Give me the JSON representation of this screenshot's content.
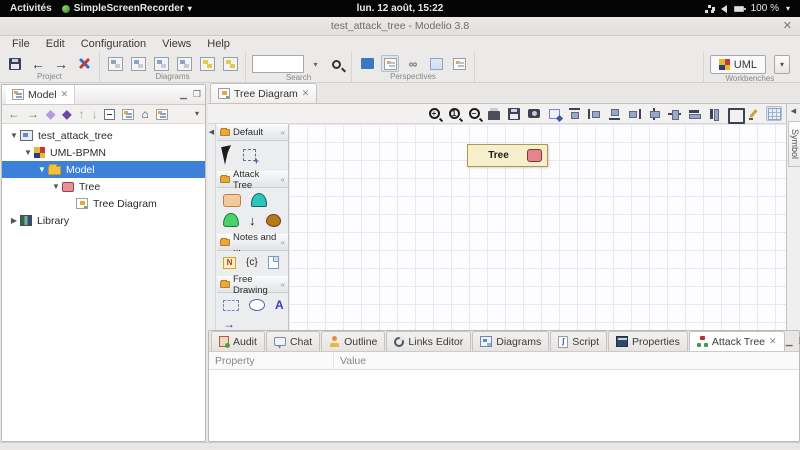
{
  "desktop": {
    "activities_label": "Activités",
    "recorder_label": "SimpleScreenRecorder",
    "clock": "lun. 12 août, 15:22",
    "battery_label": "100 %"
  },
  "window": {
    "title": "test_attack_tree - Modelio 3.8"
  },
  "menus": {
    "items": [
      {
        "label": "File"
      },
      {
        "label": "Edit"
      },
      {
        "label": "Configuration"
      },
      {
        "label": "Views"
      },
      {
        "label": "Help"
      }
    ]
  },
  "toolbar": {
    "project_label": "Project",
    "diagrams_label": "Diagrams",
    "search_label": "Search",
    "perspectives_label": "Perspectives",
    "workbenches_label": "Workbenches",
    "workbench_value": "UML",
    "search_value": "",
    "icons": [
      "save-icon",
      "undo-icon",
      "redo-icon",
      "tools-icon",
      "diagram-type-icons",
      "search-icon",
      "model-explorer-icon",
      "outline-perspective-icon",
      "links-perspective-icon",
      "grid-perspective-icon",
      "matrix-perspective-icon",
      "workbench-cube-icon"
    ]
  },
  "model_panel": {
    "tab_label": "Model",
    "nav_icons": [
      "back-arrow-icon",
      "forward-arrow-icon",
      "related-diamond-icon",
      "related-diamond-dark-icon",
      "move-up-icon",
      "move-down-icon",
      "collapse-all-icon",
      "link-with-editor-icon",
      "home-icon",
      "sync-tree-icon"
    ],
    "tree": [
      {
        "label": "test_attack_tree",
        "icon": "project-icon"
      },
      {
        "label": "UML-BPMN",
        "icon": "module-cube-icon"
      },
      {
        "label": "Model",
        "icon": "folder-icon",
        "selected": true
      },
      {
        "label": "Tree",
        "icon": "tree-element-icon"
      },
      {
        "label": "Tree Diagram",
        "icon": "diagram-icon"
      },
      {
        "label": "Library",
        "icon": "library-icon"
      }
    ]
  },
  "editor": {
    "tab_label": "Tree Diagram",
    "symbol_tab_label": "Symbol",
    "toolbar_icons": [
      "zoom-in-icon",
      "zoom-original-icon",
      "zoom-out-icon",
      "print-icon",
      "save-image-icon",
      "screenshot-icon",
      "marquee-zoom-icon",
      "align-top-icon",
      "align-left-icon",
      "align-bottom-icon",
      "align-right-icon",
      "center-vertical-icon",
      "center-horizontal-icon",
      "same-width-icon",
      "same-height-icon",
      "fit-to-content-icon",
      "format-painter-icon",
      "grid-toggle-icon"
    ],
    "palette": {
      "sections": [
        {
          "title": "Default",
          "items": [
            "select-tool",
            "marquee-tool"
          ]
        },
        {
          "title": "Attack Tree",
          "items": [
            "tree-root-tool",
            "and-gate-tool",
            "or-gate-tool",
            "connector-tool",
            "leaf-node-tool"
          ]
        },
        {
          "title": "Notes and ...",
          "items": [
            "note-tool",
            "constraint-tool",
            "document-tool"
          ]
        },
        {
          "title": "Free Drawing",
          "items": [
            "rectangle-tool",
            "ellipse-tool",
            "text-tool",
            "line-tool"
          ]
        }
      ],
      "note_letter": "N",
      "constraint_text": "{c}",
      "text_tool_letter": "A"
    },
    "canvas": {
      "node_label": "Tree"
    }
  },
  "bottom_panel": {
    "tabs": [
      {
        "label": "Audit",
        "icon": "audit-icon"
      },
      {
        "label": "Chat",
        "icon": "chat-icon"
      },
      {
        "label": "Outline",
        "icon": "outline-icon"
      },
      {
        "label": "Links Editor",
        "icon": "links-editor-icon"
      },
      {
        "label": "Diagrams",
        "icon": "diagrams-icon"
      },
      {
        "label": "Script",
        "icon": "script-icon"
      },
      {
        "label": "Properties",
        "icon": "properties-icon"
      },
      {
        "label": "Attack Tree",
        "icon": "attack-tree-icon",
        "active": true
      }
    ],
    "columns": [
      {
        "label": "Property"
      },
      {
        "label": "Value"
      }
    ]
  },
  "glyphs": {
    "menu_caret": "▾",
    "close": "✕",
    "tab_close": "✕",
    "minimize": "▁",
    "maximize": "❒",
    "expander_open": "▼",
    "expander_closed": "▶",
    "back_arrow": "←",
    "forward_arrow": "→",
    "up_arrow": "↑",
    "down_arrow": "↓",
    "diamond": "◆",
    "double_diamond": "◆◆",
    "home": "⌂",
    "collapse_left": "◀",
    "section_collapse": "«",
    "dropdown": "▾",
    "zoom_plus": "+",
    "zoom_one": "1",
    "zoom_minus": "−",
    "down_tool": "↓",
    "arrow_tool": "→"
  },
  "colors": {
    "selection_blue": "#3d80d8",
    "node_fill": "#f7eecb",
    "node_border": "#a89a55",
    "node_chip": "#e2858e",
    "canvas_grid": "#eae7f0"
  }
}
